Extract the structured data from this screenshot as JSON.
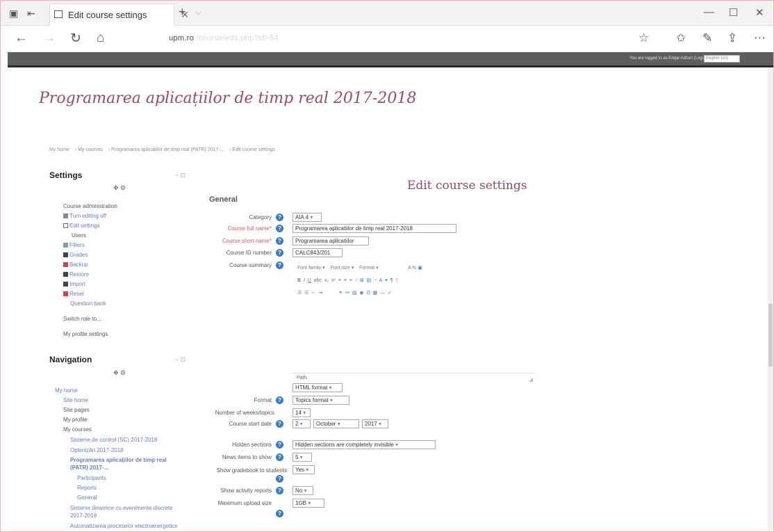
{
  "browser": {
    "tab_title": "Edit course settings",
    "url": "upm.ro",
    "url_rest": "/course/edit.php?id=54"
  },
  "top": {
    "login_text": "You are logged in as Edgar Adrian (Logout)",
    "login_box": "English (en)"
  },
  "course_title": "Programarea aplicațiilor de timp real 2017-2018",
  "breadcrumb": [
    "My home",
    "My courses",
    "Programarea aplicațiilor de timp real (PATR) 2017-...",
    "Edit course settings"
  ],
  "settings": {
    "title": "Settings",
    "items": [
      "Course administration",
      "Turn editing off",
      "Edit settings",
      "Users",
      "Filters",
      "Grades",
      "Backup",
      "Restore",
      "Import",
      "Reset",
      "Question bank",
      "Switch role to...",
      "My profile settings"
    ]
  },
  "navigation": {
    "title": "Navigation",
    "items": [
      "My home",
      "Site home",
      "Site pages",
      "My profile",
      "My courses",
      "Sisteme de control (SC) 2017-2018",
      "Optimizări 2017-2018",
      "Programarea aplicațiilor de timp real",
      "(PATR) 2017-...",
      "Participants",
      "Reports",
      "General",
      "Sisteme dinamice cu evenimente discrete",
      "2017-2018",
      "Automatizarea proceselor electroenergetice"
    ]
  },
  "page_heading": "Edit course settings",
  "section": "General",
  "form": {
    "category_label": "Category",
    "category_value": "AIA 4",
    "fullname_label": "Course full name*",
    "fullname_value": "Programarea aplicatiilor de timp real 2017-2018",
    "shortname_label": "Course short name*",
    "shortname_value": "Programarea aplicatiilor",
    "idnumber_label": "Course ID number",
    "idnumber_value": "CALC843/201",
    "summary_label": "Course summary",
    "font_family": "Font family",
    "font_size": "Font size",
    "paragraph": "Format",
    "path_label": "Path",
    "html_format": "HTML format",
    "format_label": "Format",
    "format_value": "Topics format",
    "weeks_label": "Number of weeks/topics",
    "weeks_value": "14",
    "startdate_label": "Course start date",
    "start_day": "2",
    "start_month": "October",
    "start_year": "2017",
    "hidden_label": "Hidden sections",
    "hidden_value": "Hidden sections are completely invisible",
    "news_label": "News items to show",
    "news_value": "5",
    "gradebook_label": "Show gradebook to students",
    "gradebook_value": "Yes",
    "activity_label": "Show activity reports",
    "activity_value": "No",
    "upload_label": "Maximum upload size",
    "upload_value": "1GB"
  }
}
